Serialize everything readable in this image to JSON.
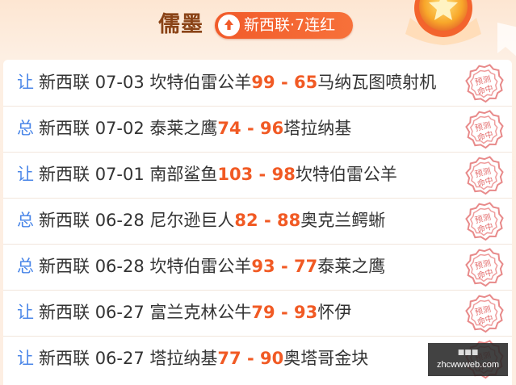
{
  "header": {
    "expert_name": "儒墨",
    "streak_badge": "新西联·7连红",
    "colors": {
      "name": "#8a4316",
      "badge": "#f15b2a",
      "score": "#f15a24",
      "type": "#4a86e8"
    }
  },
  "icons": {
    "streak": "up-arrow-icon",
    "medal": "star-medal-icon",
    "stamp": "prediction-hit-stamp-icon"
  },
  "rows": [
    {
      "type": "让",
      "league": "新西联",
      "date": "07-03",
      "home": "坎特伯雷公羊",
      "home_score": "99",
      "sep": " - ",
      "away_score": "65",
      "away": "马纳瓦图喷射机",
      "stamp": "预测命中"
    },
    {
      "type": "总",
      "league": "新西联",
      "date": "07-02",
      "home": "泰莱之鹰",
      "home_score": "74",
      "sep": " - ",
      "away_score": "96",
      "away": "塔拉纳基",
      "stamp": "预测命中"
    },
    {
      "type": "让",
      "league": "新西联",
      "date": "07-01",
      "home": "南部鲨鱼",
      "home_score": "103",
      "sep": " - ",
      "away_score": "98",
      "away": "坎特伯雷公羊",
      "stamp": "预测命中"
    },
    {
      "type": "总",
      "league": "新西联",
      "date": "06-28",
      "home": "尼尔逊巨人",
      "home_score": "82",
      "sep": " - ",
      "away_score": "88",
      "away": "奥克兰鳄蜥",
      "stamp": "预测命中"
    },
    {
      "type": "总",
      "league": "新西联",
      "date": "06-28",
      "home": "坎特伯雷公羊",
      "home_score": "93",
      "sep": " - ",
      "away_score": "77",
      "away": "泰莱之鹰",
      "stamp": "预测命中"
    },
    {
      "type": "让",
      "league": "新西联",
      "date": "06-27",
      "home": "富兰克林公牛",
      "home_score": "79",
      "sep": " - ",
      "away_score": "93",
      "away": "怀伊",
      "stamp": "预测命中"
    },
    {
      "type": "让",
      "league": "新西联",
      "date": "06-27",
      "home": "塔拉纳基",
      "home_score": "77",
      "sep": " - ",
      "away_score": "90",
      "away": "奥塔哥金块",
      "stamp": "预测命中"
    }
  ],
  "watermark": {
    "top": "■■■",
    "url": "zhcwwweb.com"
  }
}
